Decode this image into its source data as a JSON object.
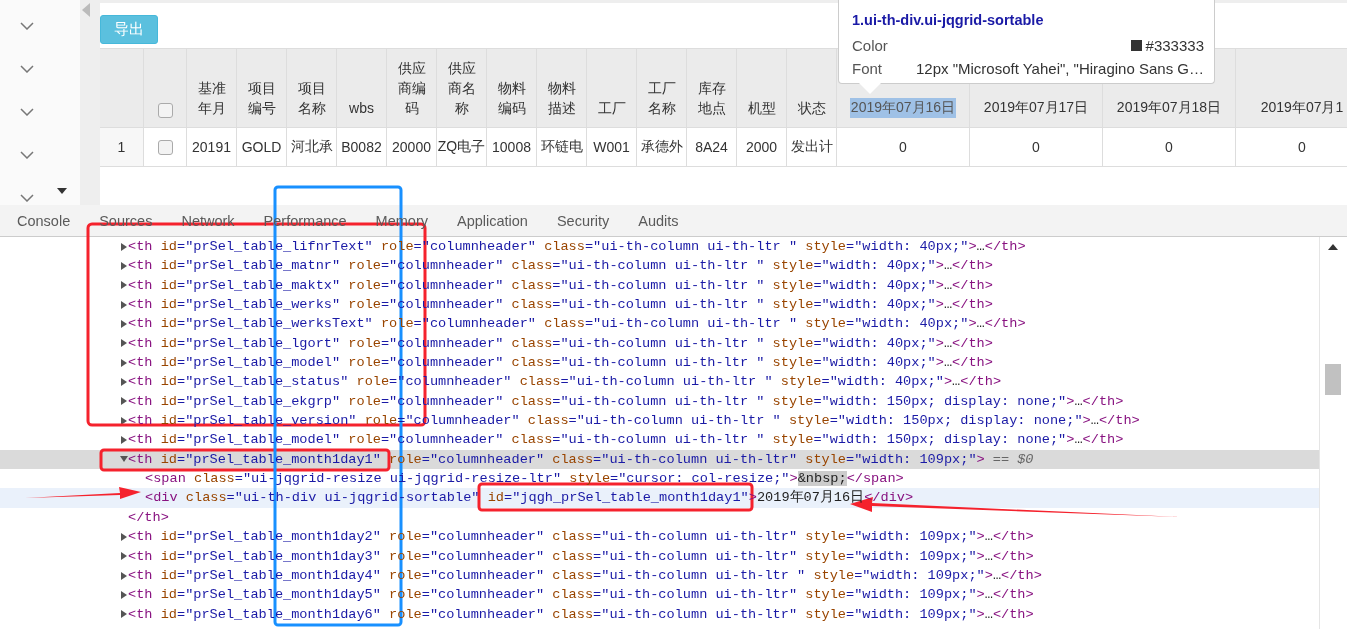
{
  "toolbar": {
    "export_button": "导出"
  },
  "table": {
    "select_all_checked": false,
    "columns": [
      {
        "kind": "text",
        "label": "基准年月"
      },
      {
        "kind": "text",
        "label": "项目编号"
      },
      {
        "kind": "text",
        "label": "项目名称"
      },
      {
        "kind": "text",
        "label": "wbs"
      },
      {
        "kind": "text",
        "label": "供应商编码"
      },
      {
        "kind": "text",
        "label": "供应商名称"
      },
      {
        "kind": "text",
        "label": "物料编码"
      },
      {
        "kind": "text",
        "label": "物料描述"
      },
      {
        "kind": "text",
        "label": "工厂"
      },
      {
        "kind": "text",
        "label": "工厂名称"
      },
      {
        "kind": "text",
        "label": "库存地点"
      },
      {
        "kind": "text",
        "label": "机型"
      },
      {
        "kind": "text",
        "label": "状态"
      },
      {
        "kind": "date",
        "label": "2019年07月16日",
        "highlighted": true
      },
      {
        "kind": "date",
        "label": "2019年07月17日",
        "highlighted": false
      },
      {
        "kind": "date",
        "label": "2019年07月18日",
        "highlighted": false
      },
      {
        "kind": "date",
        "label": "2019年07月1",
        "highlighted": false
      }
    ],
    "rows": [
      {
        "number": "1",
        "checked": false,
        "cells": [
          "20191",
          "GOLD",
          "河北承",
          "B0082",
          "20000",
          "ZQ电子",
          "10008",
          "环链电",
          "W001",
          "承德外",
          "8A24",
          "2000",
          "发出计",
          "0",
          "0",
          "0",
          "0"
        ]
      }
    ]
  },
  "inspect_tooltip": {
    "selector": "1.ui-th-div.ui-jqgrid-sortable",
    "properties": [
      {
        "kind": "color",
        "name": "Color",
        "value": "#333333"
      },
      {
        "kind": "text",
        "name": "Font",
        "value": "12px \"Microsoft Yahei\", \"Hiragino Sans G…"
      }
    ]
  },
  "devtools": {
    "tabs": [
      {
        "label": "Console",
        "selected": false
      },
      {
        "label": "Sources",
        "selected": false
      },
      {
        "label": "Network",
        "selected": false
      },
      {
        "label": "Performance",
        "selected": false
      },
      {
        "label": "Memory",
        "selected": false
      },
      {
        "label": "Application",
        "selected": false
      },
      {
        "label": "Security",
        "selected": false
      },
      {
        "label": "Audits",
        "selected": false
      }
    ],
    "dom_tree": [
      {
        "text": "<th id=\"prSel_table_lifnrText\" role=\"columnheader\" class=\"ui-th-column ui-th-ltr \" style=\"width: 40px;\">…</th>",
        "expanded": false,
        "selected": false
      },
      {
        "text": "<th id=\"prSel_table_matnr\" role=\"columnheader\" class=\"ui-th-column ui-th-ltr \" style=\"width: 40px;\">…</th>",
        "expanded": false,
        "selected": false
      },
      {
        "text": "<th id=\"prSel_table_maktx\" role=\"columnheader\" class=\"ui-th-column ui-th-ltr \" style=\"width: 40px;\">…</th>",
        "expanded": false,
        "selected": false
      },
      {
        "text": "<th id=\"prSel_table_werks\" role=\"columnheader\" class=\"ui-th-column ui-th-ltr \" style=\"width: 40px;\">…</th>",
        "expanded": false,
        "selected": false
      },
      {
        "text": "<th id=\"prSel_table_werksText\" role=\"columnheader\" class=\"ui-th-column ui-th-ltr \" style=\"width: 40px;\">…</th>",
        "expanded": false,
        "selected": false
      },
      {
        "text": "<th id=\"prSel_table_lgort\" role=\"columnheader\" class=\"ui-th-column ui-th-ltr \" style=\"width: 40px;\">…</th>",
        "expanded": false,
        "selected": false
      },
      {
        "text": "<th id=\"prSel_table_model\" role=\"columnheader\" class=\"ui-th-column ui-th-ltr \" style=\"width: 40px;\">…</th>",
        "expanded": false,
        "selected": false
      },
      {
        "text": "<th id=\"prSel_table_status\" role=\"columnheader\" class=\"ui-th-column ui-th-ltr \" style=\"width: 40px;\">…</th>",
        "expanded": false,
        "selected": false
      },
      {
        "text": "<th id=\"prSel_table_ekgrp\" role=\"columnheader\" class=\"ui-th-column ui-th-ltr \" style=\"width: 150px; display: none;\">…</th>",
        "expanded": false,
        "selected": false
      },
      {
        "text": "<th id=\"prSel_table_version\" role=\"columnheader\" class=\"ui-th-column ui-th-ltr \" style=\"width: 150px; display: none;\">…</th>",
        "expanded": false,
        "selected": false
      },
      {
        "text": "<th id=\"prSel_table_model\" role=\"columnheader\" class=\"ui-th-column ui-th-ltr \" style=\"width: 150px; display: none;\">…</th>",
        "expanded": false,
        "selected": false
      },
      {
        "text": "<th id=\"prSel_table_month1day1\" role=\"columnheader\" class=\"ui-th-column ui-th-ltr\" style=\"width: 109px;\">",
        "expanded": true,
        "selected": true,
        "console_ref": "== $0",
        "closing": "</th>",
        "children": [
          {
            "text": "<span class=\"ui-jqgrid-resize ui-jqgrid-resize-ltr\" style=\"cursor: col-resize;\">&nbsp;</span>",
            "hovered": false
          },
          {
            "text": "<div class=\"ui-th-div ui-jqgrid-sortable\" id=\"jqgh_prSel_table_month1day1\">2019年07月16日</div>",
            "hovered": true
          }
        ]
      },
      {
        "text": "<th id=\"prSel_table_month1day2\" role=\"columnheader\" class=\"ui-th-column ui-th-ltr\" style=\"width: 109px;\">…</th>",
        "expanded": false,
        "selected": false
      },
      {
        "text": "<th id=\"prSel_table_month1day3\" role=\"columnheader\" class=\"ui-th-column ui-th-ltr\" style=\"width: 109px;\">…</th>",
        "expanded": false,
        "selected": false
      },
      {
        "text": "<th id=\"prSel_table_month1day4\" role=\"columnheader\" class=\"ui-th-column ui-th-ltr \" style=\"width: 109px;\">…</th>",
        "expanded": false,
        "selected": false
      },
      {
        "text": "<th id=\"prSel_table_month1day5\" role=\"columnheader\" class=\"ui-th-column ui-th-ltr\" style=\"width: 109px;\">…</th>",
        "expanded": false,
        "selected": false
      },
      {
        "text": "<th id=\"prSel_table_month1day6\" role=\"columnheader\" class=\"ui-th-column ui-th-ltr\" style=\"width: 109px;\">…</th>",
        "expanded": false,
        "selected": false
      }
    ]
  }
}
